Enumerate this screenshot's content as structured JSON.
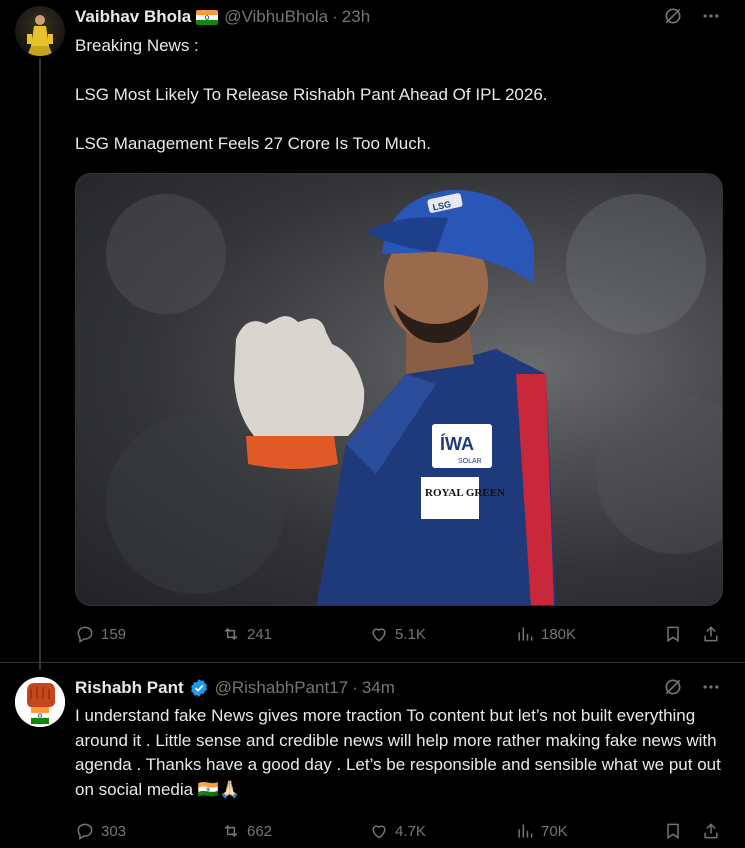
{
  "tweets": [
    {
      "author": {
        "name": "Vaibhav Bhola",
        "handle": "@VibhuBhola",
        "time": "23h",
        "flag": "india-flag"
      },
      "text": [
        "Breaking News :",
        "LSG Most Likely To Release Rishabh Pant Ahead Of IPL 2026.",
        "LSG Management Feels 27 Crore Is Too Much."
      ],
      "media": {
        "description_icon": "cricket-photo",
        "cap_badge": "LSG",
        "sponsor_1": "ÍWA",
        "sponsor_1_sub": "SOLAR",
        "sponsor_2": "ROYAL GREEN"
      },
      "stats": {
        "replies": "159",
        "reposts": "241",
        "likes": "5.1K",
        "views": "180K"
      }
    },
    {
      "author": {
        "name": "Rishabh Pant",
        "handle": "@RishabhPant17",
        "time": "34m",
        "verified": true
      },
      "text": [
        "I understand fake News gives more traction To content but let’s not built everything around it . Little sense  and credible news will help more rather making fake news with  agenda . Thanks have a good day . Let’s be responsible and  sensible what we put out on social media 🇮🇳🙏🏻"
      ],
      "stats": {
        "replies": "303",
        "reposts": "662",
        "likes": "4.7K",
        "views": "70K"
      }
    }
  ],
  "colors": {
    "background": "#000000",
    "text": "#e7e9ea",
    "muted": "#71767b",
    "verified": "#1d9bf0",
    "divider": "#2f3336"
  }
}
